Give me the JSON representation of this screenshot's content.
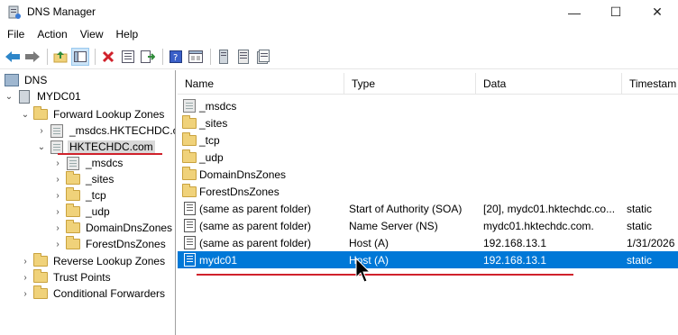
{
  "window": {
    "title": "DNS Manager",
    "controls": {
      "minimize": "—",
      "maximize": "☐",
      "close": "✕"
    }
  },
  "menu": [
    "File",
    "Action",
    "View",
    "Help"
  ],
  "toolbar": {
    "buttons": [
      "back-icon",
      "forward-icon",
      "up-folder-icon",
      "show-hide-tree-icon",
      "delete-icon",
      "properties-icon",
      "export-list-icon",
      "help-icon",
      "properties-pane-icon",
      "record-icon",
      "new-host-icon",
      "new-record-icon"
    ]
  },
  "tree": {
    "root": "DNS",
    "server": "MYDC01",
    "forward_zones": "Forward Lookup Zones",
    "msdcs_zone": "_msdcs.HKTECHDC.c",
    "hktechdc_zone": "HKTECHDC.com",
    "sub_items": [
      "_msdcs",
      "_sites",
      "_tcp",
      "_udp",
      "DomainDnsZones",
      "ForestDnsZones"
    ],
    "reverse_zones": "Reverse Lookup Zones",
    "trust_points": "Trust Points",
    "conditional_forwarders": "Conditional Forwarders"
  },
  "list": {
    "columns": [
      "Name",
      "Type",
      "Data",
      "Timestam"
    ],
    "rows": [
      {
        "name": "_msdcs",
        "type": "",
        "data": "",
        "timestamp": "",
        "icon": "zone-icon"
      },
      {
        "name": "_sites",
        "type": "",
        "data": "",
        "timestamp": "",
        "icon": "folder-icon"
      },
      {
        "name": "_tcp",
        "type": "",
        "data": "",
        "timestamp": "",
        "icon": "folder-icon"
      },
      {
        "name": "_udp",
        "type": "",
        "data": "",
        "timestamp": "",
        "icon": "folder-icon"
      },
      {
        "name": "DomainDnsZones",
        "type": "",
        "data": "",
        "timestamp": "",
        "icon": "folder-icon"
      },
      {
        "name": "ForestDnsZones",
        "type": "",
        "data": "",
        "timestamp": "",
        "icon": "folder-icon"
      },
      {
        "name": "(same as parent folder)",
        "type": "Start of Authority (SOA)",
        "data": "[20], mydc01.hktechdc.co...",
        "timestamp": "static",
        "icon": "record-icon"
      },
      {
        "name": "(same as parent folder)",
        "type": "Name Server (NS)",
        "data": "mydc01.hktechdc.com.",
        "timestamp": "static",
        "icon": "record-icon"
      },
      {
        "name": "(same as parent folder)",
        "type": "Host (A)",
        "data": "192.168.13.1",
        "timestamp": "1/31/2026",
        "icon": "record-icon"
      },
      {
        "name": "mydc01",
        "type": "Host (A)",
        "data": "192.168.13.1",
        "timestamp": "static",
        "icon": "record-icon"
      }
    ]
  },
  "colors": {
    "selection": "#0078d7",
    "annotation_red": "#d0212b",
    "tree_selected": "#d9d9d9"
  }
}
